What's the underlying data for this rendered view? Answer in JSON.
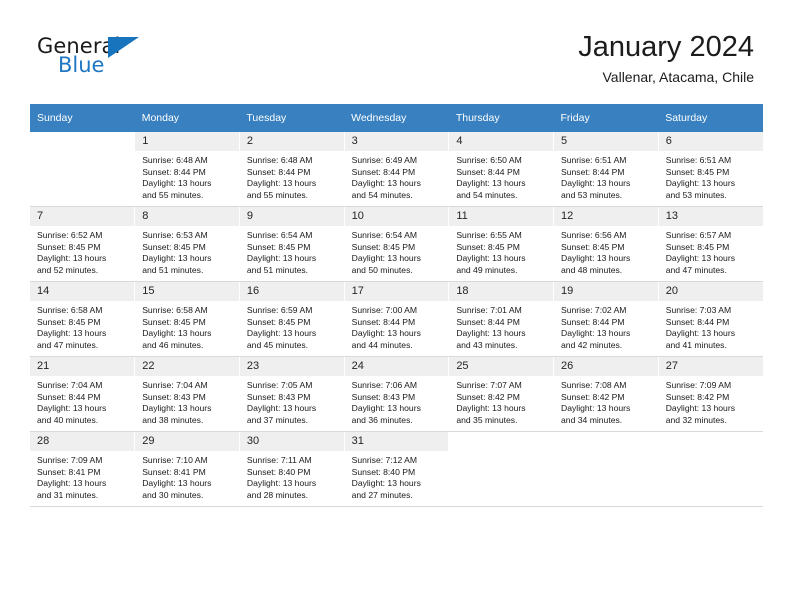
{
  "brand": {
    "name_top": "General",
    "name_bottom": "Blue",
    "logo_icon": "triangle-logo-icon"
  },
  "header": {
    "title": "January 2024",
    "subtitle": "Vallenar, Atacama, Chile"
  },
  "calendar": {
    "weekday_headers": [
      "Sunday",
      "Monday",
      "Tuesday",
      "Wednesday",
      "Thursday",
      "Friday",
      "Saturday"
    ],
    "accent_color": "#3880c0",
    "daynum_bg": "#efefef",
    "weeks": [
      [
        {
          "day": "",
          "lines": []
        },
        {
          "day": "1",
          "lines": [
            "Sunrise: 6:48 AM",
            "Sunset: 8:44 PM",
            "Daylight: 13 hours",
            "and 55 minutes."
          ]
        },
        {
          "day": "2",
          "lines": [
            "Sunrise: 6:48 AM",
            "Sunset: 8:44 PM",
            "Daylight: 13 hours",
            "and 55 minutes."
          ]
        },
        {
          "day": "3",
          "lines": [
            "Sunrise: 6:49 AM",
            "Sunset: 8:44 PM",
            "Daylight: 13 hours",
            "and 54 minutes."
          ]
        },
        {
          "day": "4",
          "lines": [
            "Sunrise: 6:50 AM",
            "Sunset: 8:44 PM",
            "Daylight: 13 hours",
            "and 54 minutes."
          ]
        },
        {
          "day": "5",
          "lines": [
            "Sunrise: 6:51 AM",
            "Sunset: 8:44 PM",
            "Daylight: 13 hours",
            "and 53 minutes."
          ]
        },
        {
          "day": "6",
          "lines": [
            "Sunrise: 6:51 AM",
            "Sunset: 8:45 PM",
            "Daylight: 13 hours",
            "and 53 minutes."
          ]
        }
      ],
      [
        {
          "day": "7",
          "lines": [
            "Sunrise: 6:52 AM",
            "Sunset: 8:45 PM",
            "Daylight: 13 hours",
            "and 52 minutes."
          ]
        },
        {
          "day": "8",
          "lines": [
            "Sunrise: 6:53 AM",
            "Sunset: 8:45 PM",
            "Daylight: 13 hours",
            "and 51 minutes."
          ]
        },
        {
          "day": "9",
          "lines": [
            "Sunrise: 6:54 AM",
            "Sunset: 8:45 PM",
            "Daylight: 13 hours",
            "and 51 minutes."
          ]
        },
        {
          "day": "10",
          "lines": [
            "Sunrise: 6:54 AM",
            "Sunset: 8:45 PM",
            "Daylight: 13 hours",
            "and 50 minutes."
          ]
        },
        {
          "day": "11",
          "lines": [
            "Sunrise: 6:55 AM",
            "Sunset: 8:45 PM",
            "Daylight: 13 hours",
            "and 49 minutes."
          ]
        },
        {
          "day": "12",
          "lines": [
            "Sunrise: 6:56 AM",
            "Sunset: 8:45 PM",
            "Daylight: 13 hours",
            "and 48 minutes."
          ]
        },
        {
          "day": "13",
          "lines": [
            "Sunrise: 6:57 AM",
            "Sunset: 8:45 PM",
            "Daylight: 13 hours",
            "and 47 minutes."
          ]
        }
      ],
      [
        {
          "day": "14",
          "lines": [
            "Sunrise: 6:58 AM",
            "Sunset: 8:45 PM",
            "Daylight: 13 hours",
            "and 47 minutes."
          ]
        },
        {
          "day": "15",
          "lines": [
            "Sunrise: 6:58 AM",
            "Sunset: 8:45 PM",
            "Daylight: 13 hours",
            "and 46 minutes."
          ]
        },
        {
          "day": "16",
          "lines": [
            "Sunrise: 6:59 AM",
            "Sunset: 8:45 PM",
            "Daylight: 13 hours",
            "and 45 minutes."
          ]
        },
        {
          "day": "17",
          "lines": [
            "Sunrise: 7:00 AM",
            "Sunset: 8:44 PM",
            "Daylight: 13 hours",
            "and 44 minutes."
          ]
        },
        {
          "day": "18",
          "lines": [
            "Sunrise: 7:01 AM",
            "Sunset: 8:44 PM",
            "Daylight: 13 hours",
            "and 43 minutes."
          ]
        },
        {
          "day": "19",
          "lines": [
            "Sunrise: 7:02 AM",
            "Sunset: 8:44 PM",
            "Daylight: 13 hours",
            "and 42 minutes."
          ]
        },
        {
          "day": "20",
          "lines": [
            "Sunrise: 7:03 AM",
            "Sunset: 8:44 PM",
            "Daylight: 13 hours",
            "and 41 minutes."
          ]
        }
      ],
      [
        {
          "day": "21",
          "lines": [
            "Sunrise: 7:04 AM",
            "Sunset: 8:44 PM",
            "Daylight: 13 hours",
            "and 40 minutes."
          ]
        },
        {
          "day": "22",
          "lines": [
            "Sunrise: 7:04 AM",
            "Sunset: 8:43 PM",
            "Daylight: 13 hours",
            "and 38 minutes."
          ]
        },
        {
          "day": "23",
          "lines": [
            "Sunrise: 7:05 AM",
            "Sunset: 8:43 PM",
            "Daylight: 13 hours",
            "and 37 minutes."
          ]
        },
        {
          "day": "24",
          "lines": [
            "Sunrise: 7:06 AM",
            "Sunset: 8:43 PM",
            "Daylight: 13 hours",
            "and 36 minutes."
          ]
        },
        {
          "day": "25",
          "lines": [
            "Sunrise: 7:07 AM",
            "Sunset: 8:42 PM",
            "Daylight: 13 hours",
            "and 35 minutes."
          ]
        },
        {
          "day": "26",
          "lines": [
            "Sunrise: 7:08 AM",
            "Sunset: 8:42 PM",
            "Daylight: 13 hours",
            "and 34 minutes."
          ]
        },
        {
          "day": "27",
          "lines": [
            "Sunrise: 7:09 AM",
            "Sunset: 8:42 PM",
            "Daylight: 13 hours",
            "and 32 minutes."
          ]
        }
      ],
      [
        {
          "day": "28",
          "lines": [
            "Sunrise: 7:09 AM",
            "Sunset: 8:41 PM",
            "Daylight: 13 hours",
            "and 31 minutes."
          ]
        },
        {
          "day": "29",
          "lines": [
            "Sunrise: 7:10 AM",
            "Sunset: 8:41 PM",
            "Daylight: 13 hours",
            "and 30 minutes."
          ]
        },
        {
          "day": "30",
          "lines": [
            "Sunrise: 7:11 AM",
            "Sunset: 8:40 PM",
            "Daylight: 13 hours",
            "and 28 minutes."
          ]
        },
        {
          "day": "31",
          "lines": [
            "Sunrise: 7:12 AM",
            "Sunset: 8:40 PM",
            "Daylight: 13 hours",
            "and 27 minutes."
          ]
        },
        {
          "day": "",
          "lines": []
        },
        {
          "day": "",
          "lines": []
        },
        {
          "day": "",
          "lines": []
        }
      ]
    ]
  }
}
